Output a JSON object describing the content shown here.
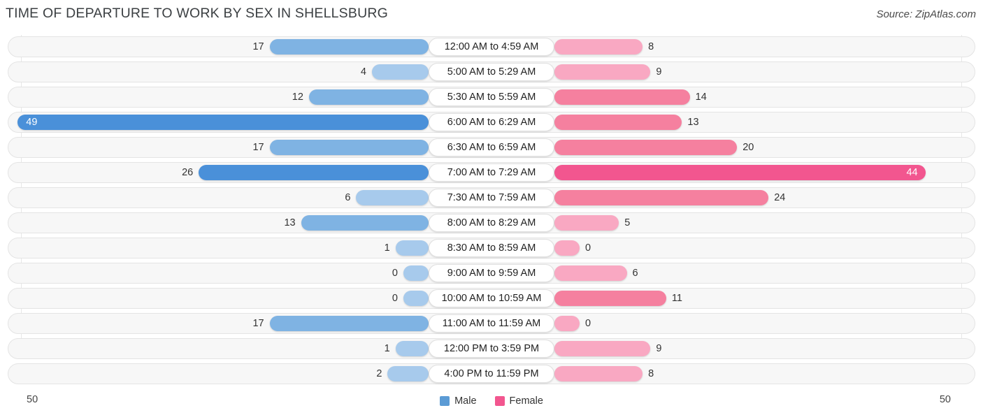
{
  "header": {
    "title": "TIME OF DEPARTURE TO WORK BY SEX IN SHELLSBURG",
    "source": "Source: ZipAtlas.com"
  },
  "axis": {
    "left_label": "50",
    "right_label": "50"
  },
  "legend": [
    {
      "label": "Male",
      "color": "#5b9bd5"
    },
    {
      "label": "Female",
      "color": "#f2568f"
    }
  ],
  "colors": {
    "male_strong": "#4a90d9",
    "male_mid": "#7fb3e3",
    "male_light": "#a7caec",
    "female_strong": "#f2568f",
    "female_mid": "#f5809f",
    "female_light": "#f9a8c2",
    "row_track": "#f7f7f7",
    "row_border": "#e4e4e4"
  },
  "chart_data": {
    "type": "bar",
    "title": "TIME OF DEPARTURE TO WORK BY SEX IN SHELLSBURG",
    "orientation": "horizontal-diverging",
    "xlabel": "",
    "ylabel": "",
    "xlim": [
      -50,
      50
    ],
    "axis_max": 50,
    "grid": false,
    "legend_position": "bottom-center",
    "categories": [
      "12:00 AM to 4:59 AM",
      "5:00 AM to 5:29 AM",
      "5:30 AM to 5:59 AM",
      "6:00 AM to 6:29 AM",
      "6:30 AM to 6:59 AM",
      "7:00 AM to 7:29 AM",
      "7:30 AM to 7:59 AM",
      "8:00 AM to 8:29 AM",
      "8:30 AM to 8:59 AM",
      "9:00 AM to 9:59 AM",
      "10:00 AM to 10:59 AM",
      "11:00 AM to 11:59 AM",
      "12:00 PM to 3:59 PM",
      "4:00 PM to 11:59 PM"
    ],
    "series": [
      {
        "name": "Male",
        "values": [
          17,
          4,
          12,
          49,
          17,
          26,
          6,
          13,
          1,
          0,
          0,
          17,
          1,
          2
        ]
      },
      {
        "name": "Female",
        "values": [
          8,
          9,
          14,
          13,
          20,
          44,
          24,
          5,
          0,
          6,
          11,
          0,
          9,
          8
        ]
      }
    ]
  }
}
